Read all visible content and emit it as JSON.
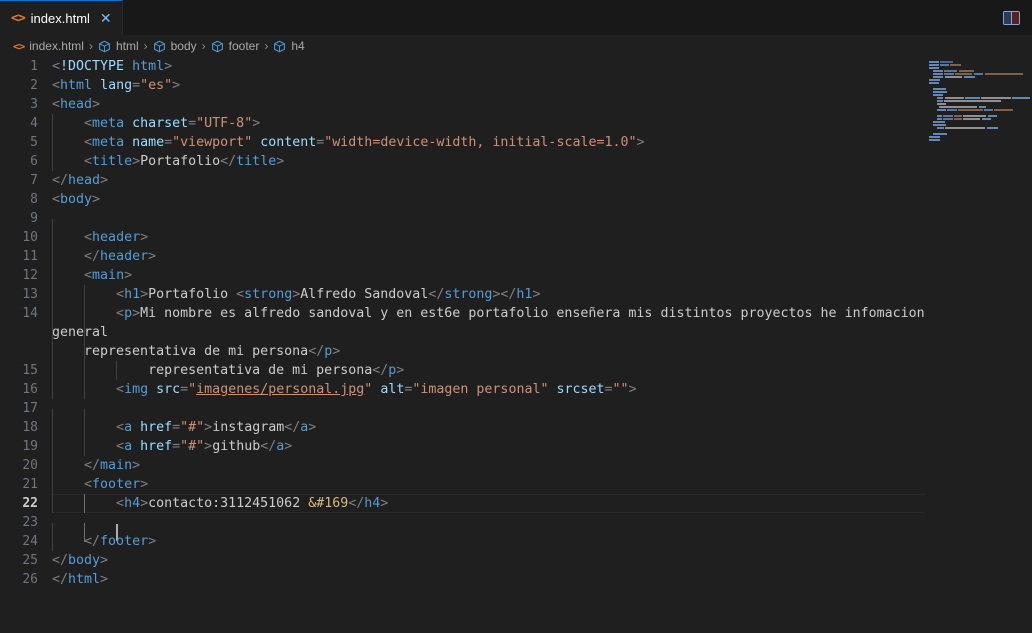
{
  "window": {
    "title": "index.html"
  },
  "tab": {
    "icon": "html-file-icon",
    "label": "index.html",
    "close_glyph": "✕"
  },
  "toolbar": {
    "layout_toggle": "toggle-panel-icon"
  },
  "breadcrumbs": {
    "separator": "›",
    "items": [
      {
        "label": "index.html",
        "icon": "html-file-icon"
      },
      {
        "label": "html",
        "icon": "symbol-field-icon"
      },
      {
        "label": "body",
        "icon": "symbol-field-icon"
      },
      {
        "label": "footer",
        "icon": "symbol-field-icon"
      },
      {
        "label": "h4",
        "icon": "symbol-field-icon"
      }
    ]
  },
  "editor": {
    "active_line": 22,
    "total_lines": 26,
    "language": "html",
    "lines": [
      {
        "n": 1,
        "indent": 0,
        "tokens": [
          {
            "t": "pu",
            "v": "<"
          },
          {
            "t": "att",
            "v": "!DOCTYPE"
          },
          {
            "t": "txt",
            "v": " "
          },
          {
            "t": "tag",
            "v": "html"
          },
          {
            "t": "pu",
            "v": ">"
          }
        ]
      },
      {
        "n": 2,
        "indent": 0,
        "tokens": [
          {
            "t": "pu",
            "v": "<"
          },
          {
            "t": "tag",
            "v": "html"
          },
          {
            "t": "txt",
            "v": " "
          },
          {
            "t": "att",
            "v": "lang"
          },
          {
            "t": "pu",
            "v": "="
          },
          {
            "t": "str",
            "v": "\"es\""
          },
          {
            "t": "pu",
            "v": ">"
          }
        ]
      },
      {
        "n": 3,
        "indent": 0,
        "tokens": [
          {
            "t": "pu",
            "v": "<"
          },
          {
            "t": "tag",
            "v": "head"
          },
          {
            "t": "pu",
            "v": ">"
          }
        ]
      },
      {
        "n": 4,
        "indent": 1,
        "tokens": [
          {
            "t": "txt",
            "v": "    "
          },
          {
            "t": "pu",
            "v": "<"
          },
          {
            "t": "tag",
            "v": "meta"
          },
          {
            "t": "txt",
            "v": " "
          },
          {
            "t": "att",
            "v": "charset"
          },
          {
            "t": "pu",
            "v": "="
          },
          {
            "t": "str",
            "v": "\"UTF-8\""
          },
          {
            "t": "pu",
            "v": ">"
          }
        ]
      },
      {
        "n": 5,
        "indent": 1,
        "tokens": [
          {
            "t": "txt",
            "v": "    "
          },
          {
            "t": "pu",
            "v": "<"
          },
          {
            "t": "tag",
            "v": "meta"
          },
          {
            "t": "txt",
            "v": " "
          },
          {
            "t": "att",
            "v": "name"
          },
          {
            "t": "pu",
            "v": "="
          },
          {
            "t": "str",
            "v": "\"viewport\""
          },
          {
            "t": "txt",
            "v": " "
          },
          {
            "t": "att",
            "v": "content"
          },
          {
            "t": "pu",
            "v": "="
          },
          {
            "t": "str",
            "v": "\"width=device-width, initial-scale=1.0\""
          },
          {
            "t": "pu",
            "v": ">"
          }
        ]
      },
      {
        "n": 6,
        "indent": 1,
        "tokens": [
          {
            "t": "txt",
            "v": "    "
          },
          {
            "t": "pu",
            "v": "<"
          },
          {
            "t": "tag",
            "v": "title"
          },
          {
            "t": "pu",
            "v": ">"
          },
          {
            "t": "txt",
            "v": "Portafolio"
          },
          {
            "t": "pu",
            "v": "</"
          },
          {
            "t": "tag",
            "v": "title"
          },
          {
            "t": "pu",
            "v": ">"
          }
        ]
      },
      {
        "n": 7,
        "indent": 0,
        "tokens": [
          {
            "t": "pu",
            "v": "</"
          },
          {
            "t": "tag",
            "v": "head"
          },
          {
            "t": "pu",
            "v": ">"
          }
        ]
      },
      {
        "n": 8,
        "indent": 0,
        "tokens": [
          {
            "t": "pu",
            "v": "<"
          },
          {
            "t": "tag",
            "v": "body"
          },
          {
            "t": "pu",
            "v": ">"
          }
        ]
      },
      {
        "n": 9,
        "indent": 1,
        "tokens": []
      },
      {
        "n": 10,
        "indent": 1,
        "tokens": [
          {
            "t": "txt",
            "v": "    "
          },
          {
            "t": "pu",
            "v": "<"
          },
          {
            "t": "tag",
            "v": "header"
          },
          {
            "t": "pu",
            "v": ">"
          }
        ]
      },
      {
        "n": 11,
        "indent": 1,
        "tokens": [
          {
            "t": "txt",
            "v": "    "
          },
          {
            "t": "pu",
            "v": "</"
          },
          {
            "t": "tag",
            "v": "header"
          },
          {
            "t": "pu",
            "v": ">"
          }
        ]
      },
      {
        "n": 12,
        "indent": 1,
        "tokens": [
          {
            "t": "txt",
            "v": "    "
          },
          {
            "t": "pu",
            "v": "<"
          },
          {
            "t": "tag",
            "v": "main"
          },
          {
            "t": "pu",
            "v": ">"
          }
        ]
      },
      {
        "n": 13,
        "indent": 2,
        "tokens": [
          {
            "t": "txt",
            "v": "        "
          },
          {
            "t": "pu",
            "v": "<"
          },
          {
            "t": "tag",
            "v": "h1"
          },
          {
            "t": "pu",
            "v": ">"
          },
          {
            "t": "txt",
            "v": "Portafolio "
          },
          {
            "t": "pu",
            "v": "<"
          },
          {
            "t": "tag",
            "v": "strong"
          },
          {
            "t": "pu",
            "v": ">"
          },
          {
            "t": "txt",
            "v": "Alfredo Sandoval"
          },
          {
            "t": "pu",
            "v": "</"
          },
          {
            "t": "tag",
            "v": "strong"
          },
          {
            "t": "pu",
            "v": ">"
          },
          {
            "t": "pu",
            "v": "</"
          },
          {
            "t": "tag",
            "v": "h1"
          },
          {
            "t": "pu",
            "v": ">"
          }
        ]
      },
      {
        "n": 14,
        "indent": 2,
        "wrapped": [
          "general",
          "    representativa de mi persona</p>"
        ],
        "tokens": [
          {
            "t": "txt",
            "v": "        "
          },
          {
            "t": "pu",
            "v": "<"
          },
          {
            "t": "tag",
            "v": "p"
          },
          {
            "t": "pu",
            "v": ">"
          },
          {
            "t": "txt",
            "v": "Mi nombre es alfredo sandoval y en est6e portafolio enseñera mis distintos proyectos he infomacion"
          }
        ]
      },
      {
        "n": 15,
        "indent": 3,
        "tokens": [
          {
            "t": "txt",
            "v": "            representativa de mi persona"
          },
          {
            "t": "pu",
            "v": "</"
          },
          {
            "t": "tag",
            "v": "p"
          },
          {
            "t": "pu",
            "v": ">"
          }
        ]
      },
      {
        "n": 16,
        "indent": 2,
        "tokens": [
          {
            "t": "txt",
            "v": "        "
          },
          {
            "t": "pu",
            "v": "<"
          },
          {
            "t": "tag",
            "v": "img"
          },
          {
            "t": "txt",
            "v": " "
          },
          {
            "t": "att",
            "v": "src"
          },
          {
            "t": "pu",
            "v": "="
          },
          {
            "t": "str",
            "v": "\""
          },
          {
            "t": "lnk",
            "v": "imagenes/personal.jpg"
          },
          {
            "t": "str",
            "v": "\""
          },
          {
            "t": "txt",
            "v": " "
          },
          {
            "t": "att",
            "v": "alt"
          },
          {
            "t": "pu",
            "v": "="
          },
          {
            "t": "str",
            "v": "\"imagen personal\""
          },
          {
            "t": "txt",
            "v": " "
          },
          {
            "t": "att",
            "v": "srcset"
          },
          {
            "t": "pu",
            "v": "="
          },
          {
            "t": "str",
            "v": "\"\""
          },
          {
            "t": "pu",
            "v": ">"
          }
        ]
      },
      {
        "n": 17,
        "indent": 2,
        "tokens": []
      },
      {
        "n": 18,
        "indent": 2,
        "tokens": [
          {
            "t": "txt",
            "v": "        "
          },
          {
            "t": "pu",
            "v": "<"
          },
          {
            "t": "tag",
            "v": "a"
          },
          {
            "t": "txt",
            "v": " "
          },
          {
            "t": "att",
            "v": "href"
          },
          {
            "t": "pu",
            "v": "="
          },
          {
            "t": "str",
            "v": "\"#\""
          },
          {
            "t": "pu",
            "v": ">"
          },
          {
            "t": "txt",
            "v": "instagram"
          },
          {
            "t": "pu",
            "v": "</"
          },
          {
            "t": "tag",
            "v": "a"
          },
          {
            "t": "pu",
            "v": ">"
          }
        ]
      },
      {
        "n": 19,
        "indent": 2,
        "tokens": [
          {
            "t": "txt",
            "v": "        "
          },
          {
            "t": "pu",
            "v": "<"
          },
          {
            "t": "tag",
            "v": "a"
          },
          {
            "t": "txt",
            "v": " "
          },
          {
            "t": "att",
            "v": "href"
          },
          {
            "t": "pu",
            "v": "="
          },
          {
            "t": "str",
            "v": "\"#\""
          },
          {
            "t": "pu",
            "v": ">"
          },
          {
            "t": "txt",
            "v": "github"
          },
          {
            "t": "pu",
            "v": "</"
          },
          {
            "t": "tag",
            "v": "a"
          },
          {
            "t": "pu",
            "v": ">"
          }
        ]
      },
      {
        "n": 20,
        "indent": 1,
        "tokens": [
          {
            "t": "txt",
            "v": "    "
          },
          {
            "t": "pu",
            "v": "</"
          },
          {
            "t": "tag",
            "v": "main"
          },
          {
            "t": "pu",
            "v": ">"
          }
        ]
      },
      {
        "n": 21,
        "indent": 1,
        "tokens": [
          {
            "t": "txt",
            "v": "    "
          },
          {
            "t": "pu",
            "v": "<"
          },
          {
            "t": "tag",
            "v": "footer"
          },
          {
            "t": "pu",
            "v": ">"
          }
        ]
      },
      {
        "n": 22,
        "indent": 2,
        "active": true,
        "tokens": [
          {
            "t": "txt",
            "v": "        "
          },
          {
            "t": "pu",
            "v": "<"
          },
          {
            "t": "tag",
            "v": "h4"
          },
          {
            "t": "pu",
            "v": ">"
          },
          {
            "t": "txt",
            "v": "contacto:3112451062 "
          },
          {
            "t": "ent",
            "v": "&#169"
          },
          {
            "t": "pu",
            "v": "</"
          },
          {
            "t": "tag",
            "v": "h4"
          },
          {
            "t": "pu",
            "v": ">"
          }
        ]
      },
      {
        "n": 23,
        "indent": 2,
        "cursor": true,
        "tokens": []
      },
      {
        "n": 24,
        "indent": 1,
        "tokens": [
          {
            "t": "txt",
            "v": "    "
          },
          {
            "t": "pu",
            "v": "</"
          },
          {
            "t": "tag",
            "v": "footer"
          },
          {
            "t": "pu",
            "v": ">"
          }
        ]
      },
      {
        "n": 25,
        "indent": 0,
        "tokens": [
          {
            "t": "pu",
            "v": "</"
          },
          {
            "t": "tag",
            "v": "body"
          },
          {
            "t": "pu",
            "v": ">"
          }
        ]
      },
      {
        "n": 26,
        "indent": 0,
        "tokens": [
          {
            "t": "pu",
            "v": "</"
          },
          {
            "t": "tag",
            "v": "html"
          },
          {
            "t": "pu",
            "v": ">"
          }
        ]
      }
    ]
  },
  "minimap": {
    "name": "code-minimap",
    "rows": [
      {
        "indent": 0,
        "tokens": [
          [
            10,
            "#6a8fbd"
          ],
          [
            14,
            "#4b6d96"
          ]
        ]
      },
      {
        "indent": 0,
        "tokens": [
          [
            10,
            "#6a8fbd"
          ],
          [
            9,
            "#5d7fa8"
          ],
          [
            12,
            "#8a6652"
          ]
        ]
      },
      {
        "indent": 0,
        "tokens": [
          [
            10,
            "#6a8fbd"
          ]
        ]
      },
      {
        "indent": 4,
        "tokens": [
          [
            10,
            "#6a8fbd"
          ],
          [
            14,
            "#5d7fa8"
          ],
          [
            16,
            "#8a6652"
          ]
        ]
      },
      {
        "indent": 4,
        "tokens": [
          [
            10,
            "#6a8fbd"
          ],
          [
            10,
            "#5d7fa8"
          ],
          [
            18,
            "#8a6652"
          ],
          [
            10,
            "#5d7fa8"
          ],
          [
            40,
            "#8a6652"
          ]
        ]
      },
      {
        "indent": 4,
        "tokens": [
          [
            11,
            "#6a8fbd"
          ],
          [
            18,
            "#9a9a9a"
          ],
          [
            12,
            "#6a8fbd"
          ]
        ]
      },
      {
        "indent": 0,
        "tokens": [
          [
            12,
            "#6a8fbd"
          ]
        ]
      },
      {
        "indent": 0,
        "tokens": [
          [
            11,
            "#6a8fbd"
          ]
        ]
      },
      {
        "indent": 0,
        "tokens": []
      },
      {
        "indent": 4,
        "tokens": [
          [
            14,
            "#6a8fbd"
          ]
        ]
      },
      {
        "indent": 4,
        "tokens": [
          [
            15,
            "#6a8fbd"
          ]
        ]
      },
      {
        "indent": 4,
        "tokens": [
          [
            11,
            "#6a8fbd"
          ]
        ]
      },
      {
        "indent": 8,
        "tokens": [
          [
            7,
            "#6a8fbd"
          ],
          [
            21,
            "#9a9a9a"
          ],
          [
            16,
            "#6a8fbd"
          ],
          [
            32,
            "#9a9a9a"
          ],
          [
            20,
            "#6a8fbd"
          ]
        ]
      },
      {
        "indent": 8,
        "tokens": [
          [
            6,
            "#6a8fbd"
          ],
          [
            60,
            "#9a9a9a"
          ]
        ]
      },
      {
        "indent": 8,
        "tokens": [
          [
            9,
            "#9a9a9a"
          ]
        ]
      },
      {
        "indent": 10,
        "tokens": [
          [
            40,
            "#9a9a9a"
          ],
          [
            8,
            "#6a8fbd"
          ]
        ]
      },
      {
        "indent": 8,
        "tokens": [
          [
            9,
            "#6a8fbd"
          ],
          [
            10,
            "#5d7fa8"
          ],
          [
            26,
            "#8a6652"
          ],
          [
            9,
            "#5d7fa8"
          ],
          [
            20,
            "#8a6652"
          ]
        ]
      },
      {
        "indent": 0,
        "tokens": []
      },
      {
        "indent": 8,
        "tokens": [
          [
            5,
            "#6a8fbd"
          ],
          [
            10,
            "#5d7fa8"
          ],
          [
            8,
            "#8a6652"
          ],
          [
            24,
            "#9a9a9a"
          ],
          [
            10,
            "#6a8fbd"
          ]
        ]
      },
      {
        "indent": 8,
        "tokens": [
          [
            5,
            "#6a8fbd"
          ],
          [
            10,
            "#5d7fa8"
          ],
          [
            8,
            "#8a6652"
          ],
          [
            18,
            "#9a9a9a"
          ],
          [
            10,
            "#6a8fbd"
          ]
        ]
      },
      {
        "indent": 4,
        "tokens": [
          [
            13,
            "#6a8fbd"
          ]
        ]
      },
      {
        "indent": 4,
        "tokens": [
          [
            14,
            "#6a8fbd"
          ]
        ]
      },
      {
        "indent": 8,
        "tokens": [
          [
            7,
            "#6a8fbd"
          ],
          [
            42,
            "#9a9a9a"
          ],
          [
            12,
            "#6a8fbd"
          ]
        ]
      },
      {
        "indent": 0,
        "tokens": []
      },
      {
        "indent": 4,
        "tokens": [
          [
            15,
            "#6a8fbd"
          ]
        ]
      },
      {
        "indent": 0,
        "tokens": [
          [
            12,
            "#6a8fbd"
          ]
        ]
      },
      {
        "indent": 0,
        "tokens": [
          [
            12,
            "#6a8fbd"
          ]
        ]
      }
    ]
  }
}
